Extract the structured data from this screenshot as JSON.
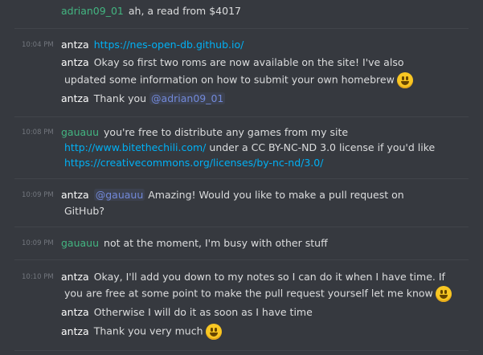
{
  "messages": {
    "m0": {
      "author": "adrian09_01",
      "text": "ah, a read from $4017"
    },
    "m1": {
      "timestamp": "10:04 PM",
      "author": "antza",
      "link": "https://nes-open-db.github.io/",
      "line2_author": "antza",
      "line2_text": "Okay so first two roms are now available on the site! I've also",
      "line3_text": "updated some information on how to submit your own homebrew",
      "line3_emoji": "smiley-emoji",
      "line4_author": "antza",
      "line4_text": "Thank you",
      "line4_mention": "@adrian09_01"
    },
    "m2": {
      "timestamp": "10:08 PM",
      "author": "gauauu",
      "line1_text": "you're free to distribute any games from my site",
      "line2_link": "http://www.bitethechili.com/",
      "line2_text": "under a CC BY-NC-ND 3.0 license if you'd like",
      "line3_link": "https://creativecommons.org/licenses/by-nc-nd/3.0/"
    },
    "m3": {
      "timestamp": "10:09 PM",
      "author": "antza",
      "mention": "@gauauu",
      "line1_text": "Amazing! Would you like to make a pull request on",
      "line2_text": "GitHub?"
    },
    "m4": {
      "timestamp": "10:09 PM",
      "author": "gauauu",
      "text": "not at the moment, I'm busy with other stuff"
    },
    "m5": {
      "timestamp": "10:10 PM",
      "author": "antza",
      "line1_text": "Okay, I'll add you down to my notes so I can do it when I have time. If",
      "line2_text": "you are free at some point to make the pull request yourself let me know",
      "line2_emoji": "smiley-emoji",
      "line3_author": "antza",
      "line3_text": "Otherwise I will do it as soon as I have time",
      "line4_author": "antza",
      "line4_text": "Thank you very much",
      "line4_emoji": "smiley-emoji"
    }
  },
  "colors": {
    "background": "#36393f",
    "text": "#dcddde",
    "author_antza": "#ffffff",
    "author_green": "#43b581",
    "link": "#00b0f4",
    "mention": "#7289da",
    "timestamp": "#72767d"
  }
}
